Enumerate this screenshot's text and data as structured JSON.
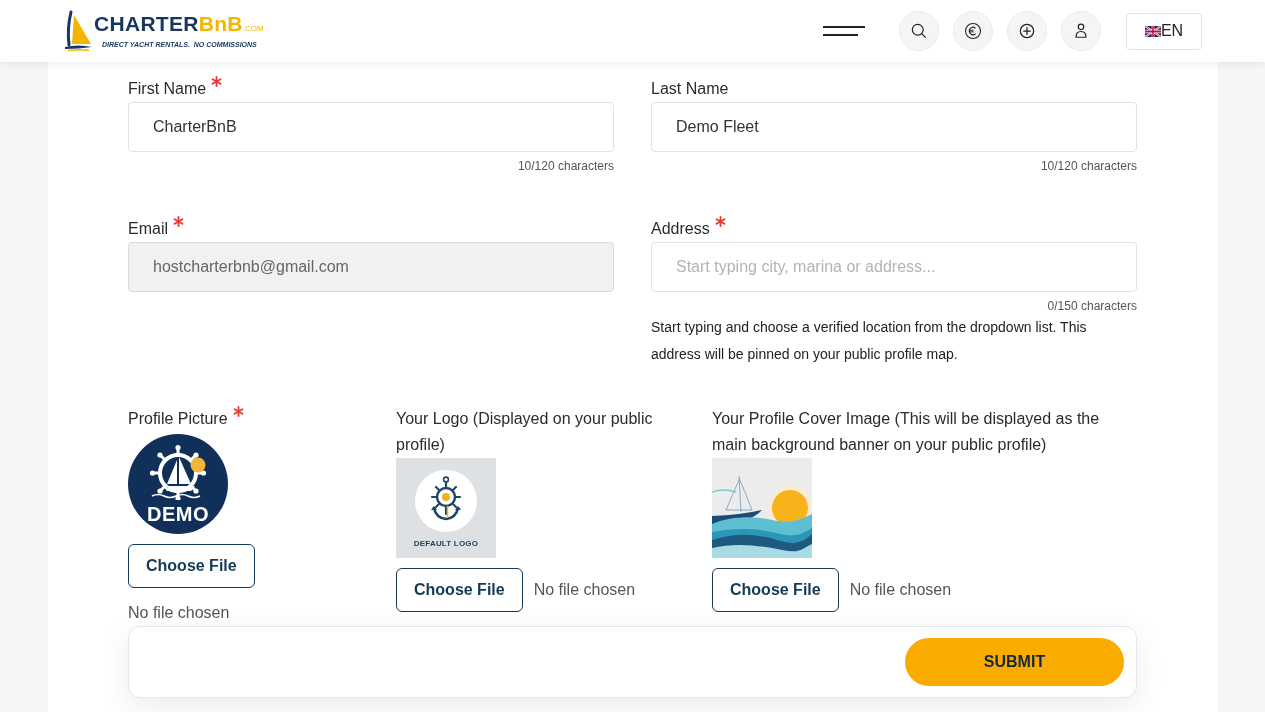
{
  "header": {
    "logo": {
      "name": "CHARTER",
      "accent": "BnB",
      "suffix": ".COM",
      "tagline": "DIRECT YACHT RENTALS.  NO COMMISSIONS"
    },
    "actions": [
      {
        "kind": "search"
      },
      {
        "kind": "currency"
      },
      {
        "kind": "add"
      },
      {
        "kind": "account"
      }
    ],
    "language": {
      "code": "EN"
    }
  },
  "form": {
    "text_fields": [
      {
        "label": "First Name",
        "required": true,
        "value": "CharterBnB",
        "counter": "10/120 characters",
        "disabled": false
      },
      {
        "label": "Last Name",
        "required": false,
        "value": "Demo Fleet",
        "counter": "10/120 characters",
        "disabled": false
      },
      {
        "label": "Email",
        "required": true,
        "value": "hostcharterbnb@gmail.com",
        "disabled": true
      },
      {
        "label": "Address",
        "required": true,
        "placeholder": "Start typing city, marina or address...",
        "counter": "0/150 characters",
        "help": "Start typing and choose a verified location from the dropdown list. This address will be pinned on your public profile map.",
        "disabled": false
      }
    ],
    "uploads": [
      {
        "kind": "avatar",
        "label": "Profile Picture",
        "required": true,
        "caption": "DEMO",
        "button": "Choose File",
        "status": "No file chosen"
      },
      {
        "kind": "logo",
        "label": "Your Logo (Displayed on your public profile)",
        "required": false,
        "caption": "DEFAULT LOGO",
        "button": "Choose File",
        "status": "No file chosen"
      },
      {
        "kind": "cover",
        "label": "Your Profile Cover Image (This will be displayed as the main background banner on your public profile)",
        "required": false,
        "button": "Choose File",
        "status": "No file chosen"
      }
    ]
  },
  "submit": {
    "label": "SUBMIT"
  }
}
